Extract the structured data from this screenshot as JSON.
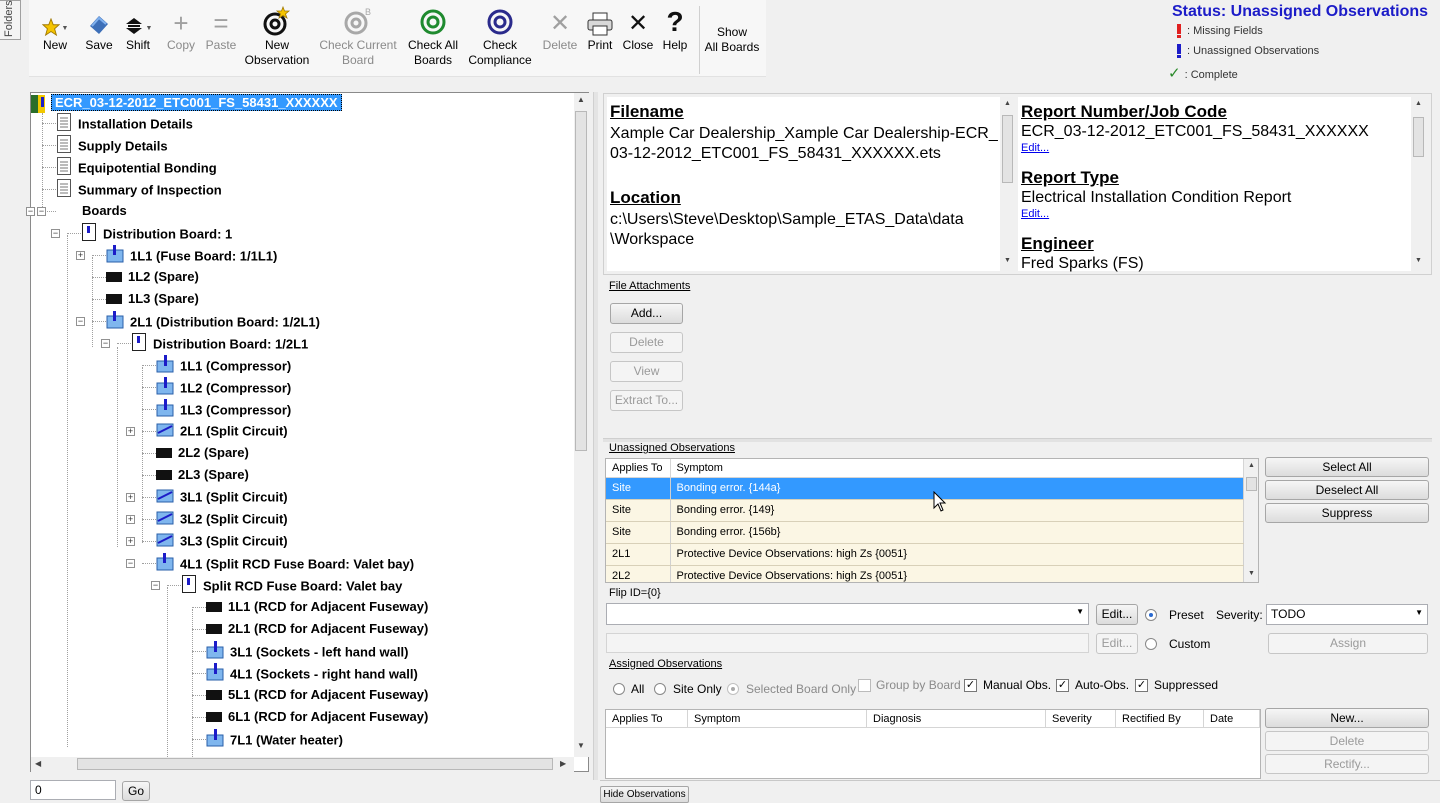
{
  "side_tab": "Folders",
  "toolbar": {
    "new": "New",
    "save": "Save",
    "shift": "Shift",
    "copy": "Copy",
    "paste": "Paste",
    "new_obs_1": "New",
    "new_obs_2": "Observation",
    "check_current_1": "Check Current",
    "check_current_2": "Board",
    "check_all_1": "Check All",
    "check_all_2": "Boards",
    "check_compliance_1": "Check",
    "check_compliance_2": "Compliance",
    "delete": "Delete",
    "print": "Print",
    "close": "Close",
    "help": "Help",
    "show_all_1": "Show",
    "show_all_2": "All Boards"
  },
  "status": {
    "title": "Status: Unassigned Observations",
    "missing": ": Missing Fields",
    "unassigned": ": Unassigned Observations",
    "complete": ": Complete",
    "colors": {
      "missing": "#e02020",
      "unassigned": "#1c1cc8",
      "complete": "#2a8a2a"
    }
  },
  "tree": {
    "root": "ECR_03-12-2012_ETC001_FS_58431_XXXXXX",
    "items": [
      "Installation Details",
      "Supply Details",
      "Equipotential Bonding",
      "Summary of Inspection",
      "Boards",
      "Distribution Board: 1",
      "1L1 (Fuse Board: 1/1L1)",
      "1L2 (Spare)",
      "1L3 (Spare)",
      "2L1 (Distribution Board: 1/2L1)",
      "Distribution Board: 1/2L1",
      "1L1 (Compressor)",
      "1L2 (Compressor)",
      "1L3 (Compressor)",
      "2L1 (Split Circuit)",
      "2L2 (Spare)",
      "2L3 (Spare)",
      "3L1 (Split Circuit)",
      "3L2 (Split Circuit)",
      "3L3 (Split Circuit)",
      "4L1 (Split RCD Fuse Board: Valet bay)",
      "Split RCD Fuse Board: Valet bay",
      "1L1 (RCD for Adjacent Fuseway)",
      "2L1 (RCD for Adjacent Fuseway)",
      "3L1 (Sockets - left hand wall)",
      "4L1 (Sockets - right hand wall)",
      "5L1 (RCD for Adjacent Fuseway)",
      "6L1 (RCD for Adjacent Fuseway)",
      "7L1 (Water heater)"
    ]
  },
  "goto": {
    "value": "0",
    "button": "Go"
  },
  "info": {
    "filename_label": "Filename",
    "filename_1": "Xample Car Dealership_Xample Car Dealership-ECR_",
    "filename_2": "03-12-2012_ETC001_FS_58431_XXXXXX.ets",
    "location_label": "Location",
    "location_1": "c:\\Users\\Steve\\Desktop\\Sample_ETAS_Data\\data",
    "location_2": "\\Workspace",
    "report_label": "Report Number/Job Code",
    "report_value": "ECR_03-12-2012_ETC001_FS_58431_XXXXXX",
    "edit": "Edit...",
    "report_type_label": "Report Type",
    "report_type_value": "Electrical Installation Condition Report",
    "engineer_label": "Engineer",
    "engineer_value": "Fred Sparks (FS)"
  },
  "attachments": {
    "title": "File Attachments",
    "add": "Add...",
    "delete": "Delete",
    "view": "View",
    "extract": "Extract To..."
  },
  "unassigned": {
    "title": "Unassigned Observations",
    "col_applies": "Applies To",
    "col_symptom": "Symptom",
    "rows": [
      {
        "applies": "Site",
        "symptom": "Bonding error. {144a}"
      },
      {
        "applies": "Site",
        "symptom": "Bonding error. {149}"
      },
      {
        "applies": "Site",
        "symptom": "Bonding error. {156b}"
      },
      {
        "applies": "2L1",
        "symptom": "Protective Device Observations: high Zs {0051}"
      },
      {
        "applies": "2L2",
        "symptom": "Protective Device Observations: high Zs {0051}"
      }
    ],
    "select_all": "Select All",
    "deselect_all": "Deselect All",
    "suppress": "Suppress",
    "flip_id": "Flip ID={0}",
    "edit": "Edit...",
    "preset": "Preset",
    "custom": "Custom",
    "severity_label": "Severity:",
    "severity_value": "TODO",
    "assign": "Assign"
  },
  "assigned": {
    "title": "Assigned Observations",
    "filter_all": "All",
    "filter_site": "Site Only",
    "filter_board": "Selected Board Only",
    "group_by_board": "Group by Board",
    "manual": "Manual Obs.",
    "auto": "Auto-Obs.",
    "suppressed": "Suppressed",
    "cols": [
      "Applies To",
      "Symptom",
      "Diagnosis",
      "Severity",
      "Rectified By",
      "Date"
    ],
    "new": "New...",
    "delete": "Delete",
    "rectify": "Rectify..."
  },
  "hide_observations": "Hide Observations"
}
